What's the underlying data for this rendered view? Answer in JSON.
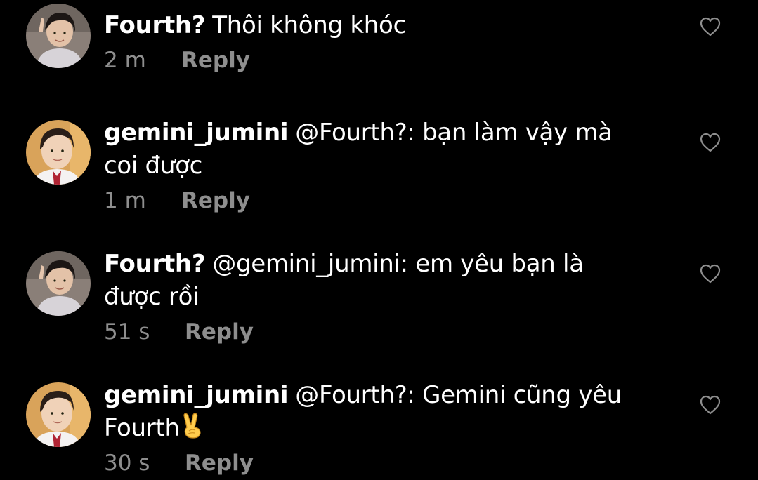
{
  "colors": {
    "background": "#000000",
    "text": "#ffffff",
    "muted": "#8e8e8e"
  },
  "comments": [
    {
      "username": "Fourth?",
      "text": "Thôi không khóc",
      "time": "2 m",
      "reply_label": "Reply",
      "avatar": "fourth-avatar"
    },
    {
      "username": "gemini_jumini",
      "text": "@Fourth?: bạn làm vậy mà coi được",
      "time": "1 m",
      "reply_label": "Reply",
      "avatar": "gemini-avatar"
    },
    {
      "username": "Fourth?",
      "text": "@gemini_jumini: em yêu bạn là được rồi",
      "time": "51 s",
      "reply_label": "Reply",
      "avatar": "fourth-avatar"
    },
    {
      "username": "gemini_jumini",
      "text": "@Fourth?: Gemini cũng yêu Fourth",
      "emoji": "victory-hand-emoji",
      "time": "30 s",
      "reply_label": "Reply",
      "avatar": "gemini-avatar"
    }
  ],
  "icons": {
    "like": "heart-outline-icon"
  }
}
